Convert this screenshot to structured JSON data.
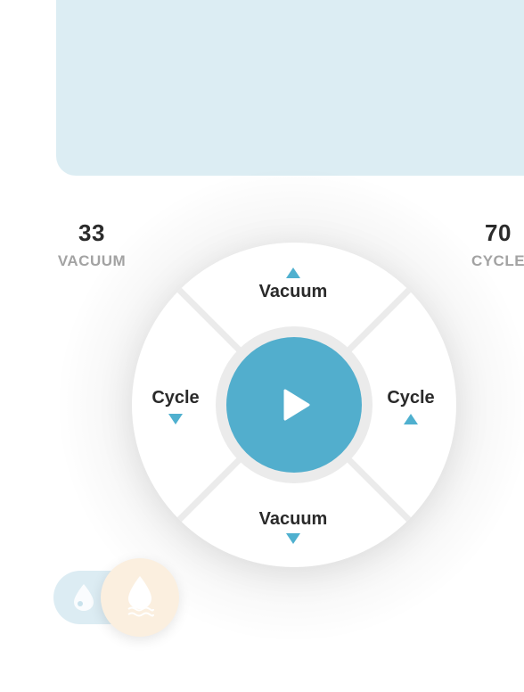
{
  "stats": {
    "vacuum": {
      "value": "33",
      "label": "VACUUM"
    },
    "cycle": {
      "value": "70",
      "label": "CYCLE"
    }
  },
  "controls": {
    "top_label": "Vacuum",
    "bottom_label": "Vacuum",
    "left_label": "Cycle",
    "right_label": "Cycle"
  },
  "icons": {
    "play": "play-icon",
    "arrow_up": "triangle-up-icon",
    "arrow_down": "triangle-down-icon",
    "drop": "water-drop-icon",
    "drop_waves": "water-drop-waves-icon"
  },
  "colors": {
    "accent": "#52aecd",
    "panel": "#dcedf3",
    "knob": "#fbefdf",
    "text": "#2a2a2a",
    "muted": "#a3a3a3"
  }
}
